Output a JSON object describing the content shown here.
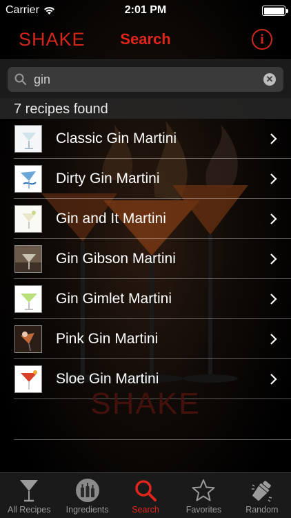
{
  "status_bar": {
    "carrier": "Carrier",
    "time": "2:01 PM"
  },
  "nav": {
    "brand": "SHAKE",
    "title": "Search"
  },
  "search": {
    "value": "gin"
  },
  "results": {
    "count_text": "7 recipes found",
    "items": [
      {
        "label": "Classic Gin Martini",
        "thumb": "martini-clear"
      },
      {
        "label": "Dirty Gin Martini",
        "thumb": "martini-blue"
      },
      {
        "label": "Gin and It Martini",
        "thumb": "martini-pale"
      },
      {
        "label": "Gin Gibson Martini",
        "thumb": "martini-dark"
      },
      {
        "label": "Gin Gimlet Martini",
        "thumb": "martini-green"
      },
      {
        "label": "Pink Gin Martini",
        "thumb": "martini-brown"
      },
      {
        "label": "Sloe Gin Martini",
        "thumb": "martini-red"
      }
    ]
  },
  "watermark": "SHAKE",
  "tabs": [
    {
      "label": "All Recipes",
      "icon": "martini-glass-icon",
      "active": false
    },
    {
      "label": "Ingredients",
      "icon": "bottles-icon",
      "active": false
    },
    {
      "label": "Search",
      "icon": "search-icon",
      "active": true
    },
    {
      "label": "Favorites",
      "icon": "star-icon",
      "active": false
    },
    {
      "label": "Random",
      "icon": "shaker-icon",
      "active": false
    }
  ],
  "colors": {
    "accent": "#e0261c",
    "background": "#000000",
    "tab_inactive": "#9a9a9a"
  }
}
